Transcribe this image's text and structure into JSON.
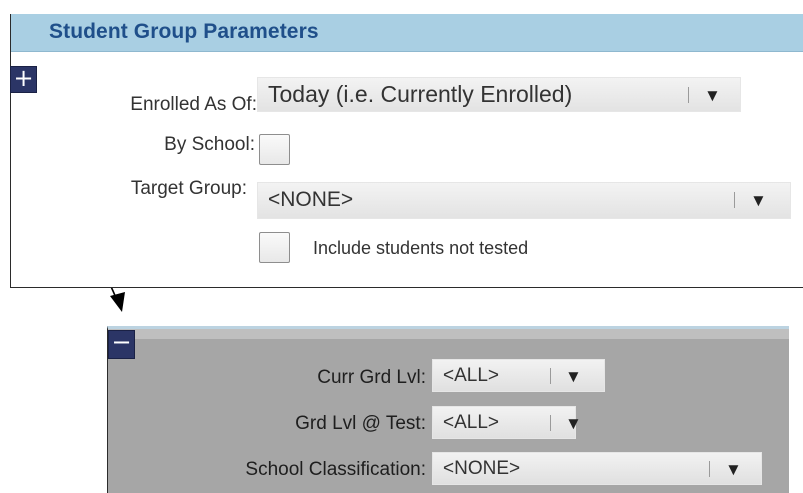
{
  "top_panel": {
    "title": "Student Group Parameters",
    "expand_symbol": "+",
    "enrolled_as_of": {
      "label": "Enrolled As Of:",
      "value": "Today (i.e. Currently Enrolled)"
    },
    "by_school": {
      "label": "By School:",
      "checked": false
    },
    "target_group": {
      "label": "Target Group:",
      "value": "<NONE>"
    },
    "include_not_tested": {
      "label": "Include students not tested",
      "checked": false
    }
  },
  "bottom_panel": {
    "collapse_symbol": "−",
    "curr_grd_lvl": {
      "label": "Curr Grd Lvl:",
      "value": "<ALL>"
    },
    "grd_lvl_at_test": {
      "label": "Grd Lvl @ Test:",
      "value": "<ALL>"
    },
    "school_classification": {
      "label": "School Classification:",
      "value": "<NONE>"
    }
  },
  "dropdown_icon": "▼",
  "colors": {
    "header_bg": "#a9cfe3",
    "header_text": "#1f4f8a",
    "toggle_bg": "#2b3566",
    "bottom_panel_bg": "#a6a6a6"
  }
}
